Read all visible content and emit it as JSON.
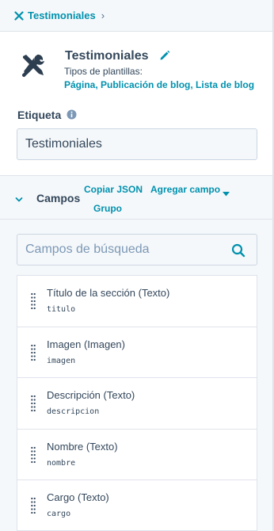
{
  "breadcrumb": {
    "icon": "close-x-icon",
    "label": "Testimoniales",
    "chevron": "›"
  },
  "module": {
    "icon": "tools-wrench-screwdriver-icon",
    "title": "Testimoniales",
    "edit_icon": "pencil-icon",
    "template_types_label": "Tipos de plantillas:",
    "template_types_value": "Página, Publicación de blog, Lista de blog"
  },
  "etiqueta": {
    "label": "Etiqueta",
    "info_icon": "info-icon",
    "value": "Testimoniales"
  },
  "campos": {
    "label": "Campos",
    "copy_json": "Copiar JSON",
    "add_field": "Agregar campo",
    "group": "Grupo"
  },
  "search": {
    "placeholder": "Campos de búsqueda",
    "value": ""
  },
  "fields": [
    {
      "title": "Título de la sección (Texto)",
      "code": "titulo"
    },
    {
      "title": "Imagen (Imagen)",
      "code": "imagen"
    },
    {
      "title": "Descripción (Texto)",
      "code": "descripcion"
    },
    {
      "title": "Nombre (Texto)",
      "code": "nombre"
    },
    {
      "title": "Cargo (Texto)",
      "code": "cargo"
    }
  ],
  "colors": {
    "link": "#0091ae",
    "text": "#33475b",
    "panel_bg": "#f5f8fa",
    "border": "#cbd6e2"
  }
}
